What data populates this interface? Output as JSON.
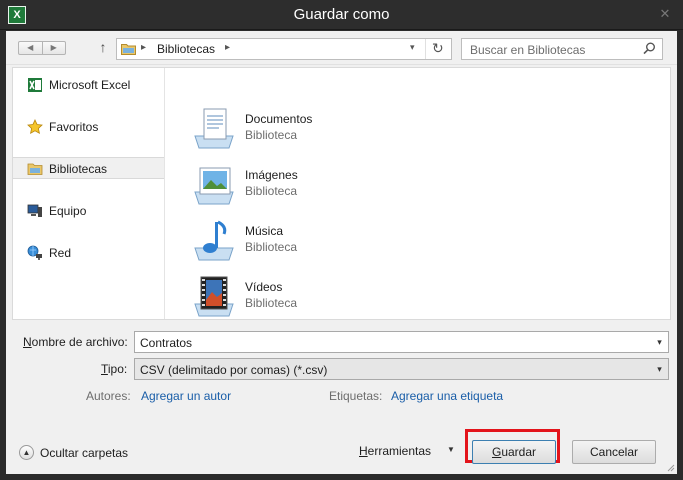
{
  "window": {
    "title": "Guardar como",
    "app_icon_letter": "X",
    "close_glyph": "✕"
  },
  "navbar": {
    "back_glyph": "◀",
    "forward_glyph": "▶",
    "up_glyph": "↑",
    "address_separator": "▸",
    "address_path": "Bibliotecas",
    "address_dropdown_glyph": "▾",
    "refresh_glyph": "↻",
    "search_placeholder": "Buscar en Bibliotecas"
  },
  "sidebar": {
    "items": [
      {
        "label": "Microsoft Excel",
        "icon": "excel-icon"
      },
      {
        "label": "Favoritos",
        "icon": "star-icon"
      },
      {
        "label": "Bibliotecas",
        "icon": "libraries-folder-icon",
        "selected": true
      },
      {
        "label": "Equipo",
        "icon": "computer-icon"
      },
      {
        "label": "Red",
        "icon": "network-icon"
      }
    ]
  },
  "libraries": [
    {
      "name": "Documentos",
      "type": "Biblioteca",
      "icon": "documents-library-icon"
    },
    {
      "name": "Imágenes",
      "type": "Biblioteca",
      "icon": "pictures-library-icon"
    },
    {
      "name": "Música",
      "type": "Biblioteca",
      "icon": "music-library-icon"
    },
    {
      "name": "Vídeos",
      "type": "Biblioteca",
      "icon": "videos-library-icon"
    }
  ],
  "form": {
    "filename_label_key": "N",
    "filename_label_rest": "ombre de archivo:",
    "filename_value": "Contratos",
    "type_label_key": "T",
    "type_label_rest": "ipo:",
    "type_value": "CSV (delimitado por comas) (*.csv)",
    "dropdown_glyph": "▾",
    "authors_label": "Autores:",
    "authors_link": "Agregar un autor",
    "tags_label": "Etiquetas:",
    "tags_link": "Agregar una etiqueta"
  },
  "footer": {
    "hide_folders_glyph": "▲",
    "hide_folders_label": "Ocultar carpetas",
    "tools_label_key": "H",
    "tools_label_rest": "erramientas",
    "tools_arrow": "▼",
    "save_key": "G",
    "save_rest": "uardar",
    "cancel_label": "Cancelar"
  },
  "colors": {
    "highlight_border": "#e3141b",
    "link": "#1a5ea8",
    "title_bar": "#2d2d2d"
  }
}
